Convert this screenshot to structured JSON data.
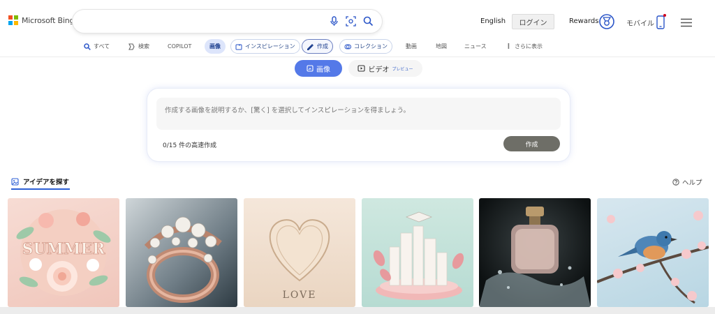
{
  "header": {
    "logo_text": "Microsoft Bing",
    "language": "English",
    "login": "ログイン",
    "rewards": "Rewards",
    "mobile": "モバイル",
    "colors": {
      "accent": "#5479e8",
      "notification_dot": "#d0021b"
    }
  },
  "search": {
    "value": "",
    "placeholder": "",
    "icons": [
      "microphone-icon",
      "visual-search-icon",
      "search-icon"
    ]
  },
  "nav": {
    "items": [
      {
        "label": "すべて",
        "icon": "search-icon"
      },
      {
        "label": "検索",
        "icon": "copilot-icon"
      },
      {
        "label": "COPILOT"
      },
      {
        "label": "画像"
      },
      {
        "label": "インスピレーション",
        "icon": "inspiration-icon"
      },
      {
        "label": "作成",
        "icon": "create-icon"
      },
      {
        "label": "コレクション",
        "icon": "collection-icon"
      },
      {
        "label": "動画"
      },
      {
        "label": "地図"
      },
      {
        "label": "ニュース"
      },
      {
        "label": "さらに表示",
        "icon": "more-dots-icon"
      }
    ]
  },
  "mode": {
    "image_label": "画像",
    "video_label": "ビデオ",
    "video_badge": "プレビュー"
  },
  "creator": {
    "placeholder": "作成する画像を説明するか、[驚く] を選択してインスピレーションを得ましょう。",
    "boosts": "0/15 件の高速作成",
    "create_button": "作成"
  },
  "ideas": {
    "tab_label": "アイデアを探す",
    "help_label": "ヘルプ",
    "tiles": [
      {
        "name": "summer-paper-flowers",
        "label": "SUMMER"
      },
      {
        "name": "rose-gold-pearl-ring",
        "label": ""
      },
      {
        "name": "paper-heart-love",
        "label": "LOVE"
      },
      {
        "name": "graduation-city",
        "label": ""
      },
      {
        "name": "perfume-bottle-splash",
        "label": ""
      },
      {
        "name": "bird-on-blossom",
        "label": ""
      }
    ]
  }
}
